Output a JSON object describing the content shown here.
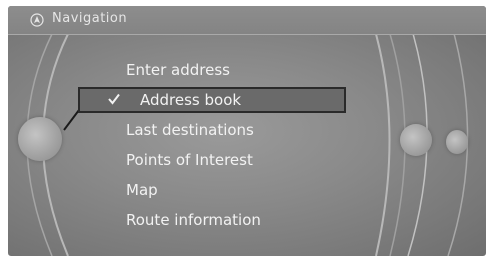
{
  "header": {
    "title": "Navigation",
    "icon": "navigation-icon"
  },
  "menu": {
    "items": [
      {
        "label": "Enter address",
        "selected": false
      },
      {
        "label": "Address book",
        "selected": true
      },
      {
        "label": "Last destinations",
        "selected": false
      },
      {
        "label": "Points of Interest",
        "selected": false
      },
      {
        "label": "Map",
        "selected": false
      },
      {
        "label": "Route information",
        "selected": false
      }
    ]
  },
  "colors": {
    "screen_background": "#8a8a8a",
    "text": "#f2f2f2",
    "selection_border": "#2a2a2a",
    "selection_background": "#6a6a6a"
  }
}
